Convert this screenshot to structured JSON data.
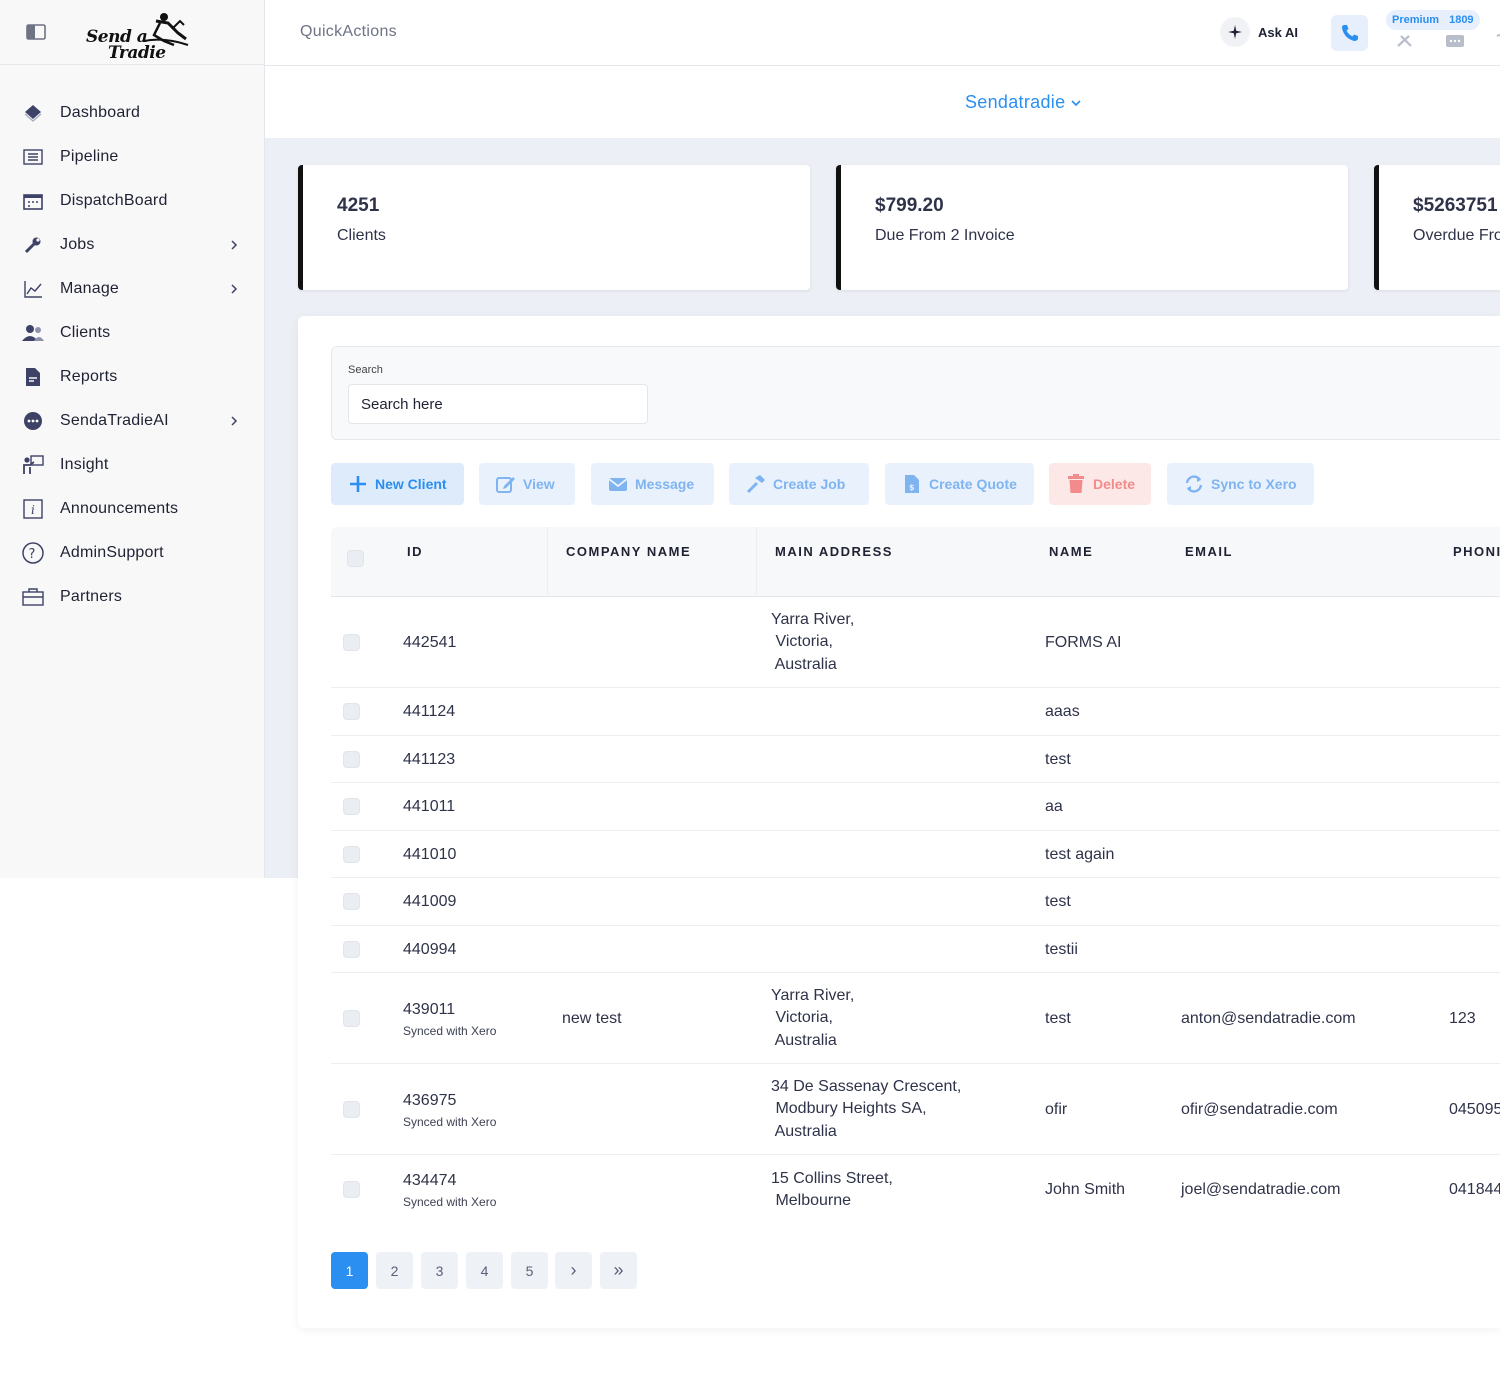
{
  "sidebar": {
    "logo": {
      "line1": "Send a",
      "line2": "Tradie"
    },
    "items": [
      {
        "label": "Dashboard",
        "icon": "diamond-icon",
        "chevron": false
      },
      {
        "label": "Pipeline",
        "icon": "list-icon",
        "chevron": false
      },
      {
        "label": "DispatchBoard",
        "icon": "calendar-icon",
        "chevron": false
      },
      {
        "label": "Jobs",
        "icon": "wrench-icon",
        "chevron": true
      },
      {
        "label": "Manage",
        "icon": "line-chart-icon",
        "chevron": true
      },
      {
        "label": "Clients",
        "icon": "users-icon",
        "chevron": false
      },
      {
        "label": "Reports",
        "icon": "document-icon",
        "chevron": false
      },
      {
        "label": "SendaTradieAI",
        "icon": "chat-bubble-icon",
        "chevron": true
      },
      {
        "label": "Insight",
        "icon": "presenter-icon",
        "chevron": false
      },
      {
        "label": "Announcements",
        "icon": "info-icon",
        "chevron": false
      },
      {
        "label": "AdminSupport",
        "icon": "question-icon",
        "chevron": false
      },
      {
        "label": "Partners",
        "icon": "briefcase-icon",
        "chevron": false
      }
    ]
  },
  "topbar": {
    "title": "QuickActions",
    "ask_ai": "Ask AI",
    "plan": "Premium",
    "plan_count": "1809"
  },
  "company": {
    "name": "Sendatradie"
  },
  "stats": [
    {
      "value": "4251",
      "label": "Clients"
    },
    {
      "value": "$799.20",
      "label": "Due From 2 Invoice"
    },
    {
      "value": "$5263751",
      "label": "Overdue Fro"
    }
  ],
  "search": {
    "label": "Search",
    "placeholder": "Search here"
  },
  "actions": {
    "new_client": "New Client",
    "view": "View",
    "message": "Message",
    "create_job": "Create Job",
    "create_quote": "Create Quote",
    "delete": "Delete",
    "sync": "Sync to Xero"
  },
  "table": {
    "headers": {
      "id": "ID",
      "company": "COMPANY NAME",
      "address": "MAIN ADDRESS",
      "name": "NAME",
      "email": "EMAIL",
      "phone": "PHONI"
    },
    "rows": [
      {
        "id": "442541",
        "sub": "",
        "company": "",
        "address": [
          "Yarra River,",
          " Victoria,",
          " Australia"
        ],
        "name": "FORMS AI",
        "email": "",
        "phone": ""
      },
      {
        "id": "441124",
        "sub": "",
        "company": "",
        "address": [],
        "name": "aaas",
        "email": "",
        "phone": ""
      },
      {
        "id": "441123",
        "sub": "",
        "company": "",
        "address": [],
        "name": "test",
        "email": "",
        "phone": ""
      },
      {
        "id": "441011",
        "sub": "",
        "company": "",
        "address": [],
        "name": "aa",
        "email": "",
        "phone": ""
      },
      {
        "id": "441010",
        "sub": "",
        "company": "",
        "address": [],
        "name": "test again",
        "email": "",
        "phone": ""
      },
      {
        "id": "441009",
        "sub": "",
        "company": "",
        "address": [],
        "name": "test",
        "email": "",
        "phone": ""
      },
      {
        "id": "440994",
        "sub": "",
        "company": "",
        "address": [],
        "name": "testii",
        "email": "",
        "phone": ""
      },
      {
        "id": "439011",
        "sub": "Synced with Xero",
        "company": "new test",
        "address": [
          "Yarra River,",
          " Victoria,",
          " Australia"
        ],
        "name": "test",
        "email": "anton@sendatradie.com",
        "phone": "123"
      },
      {
        "id": "436975",
        "sub": "Synced with Xero",
        "company": "",
        "address": [
          "34 De Sassenay Crescent,",
          " Modbury Heights SA,",
          " Australia"
        ],
        "name": "ofir",
        "email": "ofir@sendatradie.com",
        "phone": "045095"
      },
      {
        "id": "434474",
        "sub": "Synced with Xero",
        "company": "",
        "address": [
          "15 Collins Street,",
          " Melbourne"
        ],
        "name": "John Smith",
        "email": "joel@sendatradie.com",
        "phone": "041844"
      }
    ]
  },
  "pagination": {
    "pages": [
      "1",
      "2",
      "3",
      "4",
      "5"
    ],
    "active": "1",
    "next": "›",
    "last": "»"
  },
  "colors": {
    "accent": "#2a8ff0",
    "danger": "#f28b8b",
    "sidebar_bg": "#f8f8f9",
    "main_bg": "#eceff5"
  }
}
